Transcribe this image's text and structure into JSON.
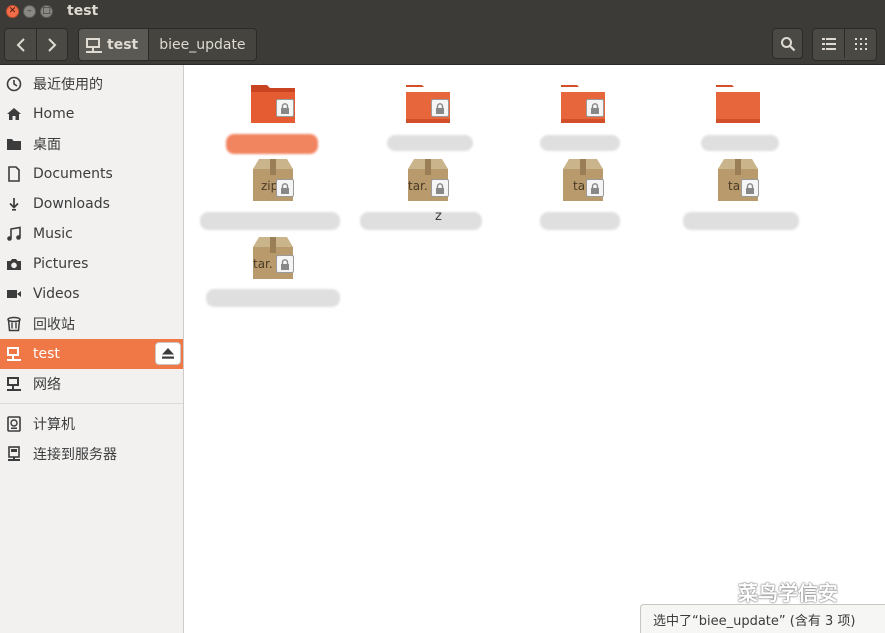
{
  "window": {
    "title": "test",
    "controls": [
      "close-icon",
      "minimize-icon",
      "maximize-icon"
    ]
  },
  "toolbar": {
    "back_icon": "chevron-left-icon",
    "forward_icon": "chevron-right-icon",
    "breadcrumbs": [
      {
        "label": "test",
        "icon": "network-drive-icon"
      },
      {
        "label": "biee_update"
      }
    ],
    "search_icon": "search-icon",
    "list_view_icon": "list-view-icon",
    "grid_view_icon": "grid-view-icon"
  },
  "sidebar": {
    "items": [
      {
        "label": "最近使用的",
        "icon": "recent-icon"
      },
      {
        "label": "Home",
        "icon": "home-icon"
      },
      {
        "label": "桌面",
        "icon": "desktop-folder-icon"
      },
      {
        "label": "Documents",
        "icon": "document-icon"
      },
      {
        "label": "Downloads",
        "icon": "download-icon"
      },
      {
        "label": "Music",
        "icon": "music-icon"
      },
      {
        "label": "Pictures",
        "icon": "camera-icon"
      },
      {
        "label": "Videos",
        "icon": "video-icon"
      },
      {
        "label": "回收站",
        "icon": "trash-icon"
      },
      {
        "label": "test",
        "icon": "network-drive-icon",
        "selected": true
      },
      {
        "label": "网络",
        "icon": "network-icon"
      },
      {
        "label": "计算机",
        "icon": "computer-icon"
      },
      {
        "label": "连接到服务器",
        "icon": "server-icon"
      }
    ],
    "eject_icon": "eject-icon"
  },
  "files": [
    {
      "type": "folder",
      "selected": true,
      "label_fragment": ""
    },
    {
      "type": "folder",
      "label_fragment": ""
    },
    {
      "type": "folder",
      "label_fragment": ""
    },
    {
      "type": "folder",
      "label_fragment": ""
    },
    {
      "type": "archive",
      "badge": "zip",
      "label_fragment": ""
    },
    {
      "type": "archive",
      "badge": "tar.",
      "label_fragment": "z"
    },
    {
      "type": "archive",
      "badge": "ta",
      "label_fragment": ""
    },
    {
      "type": "archive",
      "badge": "ta",
      "label_fragment": ""
    },
    {
      "type": "archive",
      "badge": "tar.",
      "label_fragment": ""
    }
  ],
  "status": {
    "text": "选中了“biee_update” (含有 3 项)"
  },
  "watermark": {
    "text": "菜鸟学信安"
  },
  "colors": {
    "accent": "#f07746",
    "titlebar": "#3c3b37",
    "folder": "#e55b32"
  }
}
